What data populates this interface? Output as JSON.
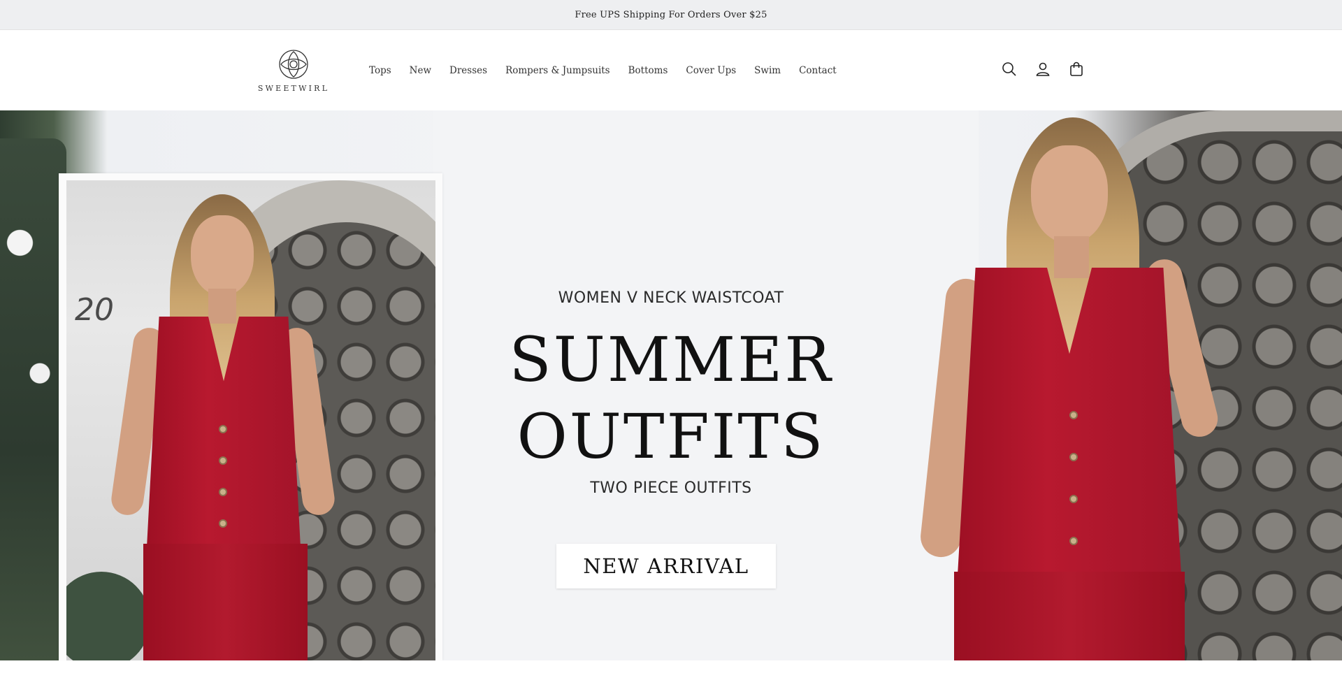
{
  "announcement": {
    "text": "Free UPS Shipping For Orders Over $25"
  },
  "header": {
    "logo_text": "SWEETWIRL",
    "nav": [
      {
        "label": "Tops"
      },
      {
        "label": "New"
      },
      {
        "label": "Dresses"
      },
      {
        "label": "Rompers & Jumpsuits"
      },
      {
        "label": "Bottoms"
      },
      {
        "label": "Cover Ups"
      },
      {
        "label": "Swim"
      },
      {
        "label": "Contact"
      }
    ],
    "icons": [
      "search-icon",
      "account-icon",
      "cart-icon"
    ]
  },
  "hero": {
    "subtitle_top": "WOMEN V NECK WAISTCOAT",
    "headline_line1": "SUMMER",
    "headline_line2": "OUTFITS",
    "subtitle_bottom": "TWO PIECE OUTFITS",
    "cta_label": "NEW ARRIVAL",
    "house_number": "20"
  },
  "colors": {
    "announcement_bg": "#eeeff1",
    "vest_red": "#b8192f",
    "cta_bg": "#ffffff",
    "text_dark": "#111111"
  }
}
